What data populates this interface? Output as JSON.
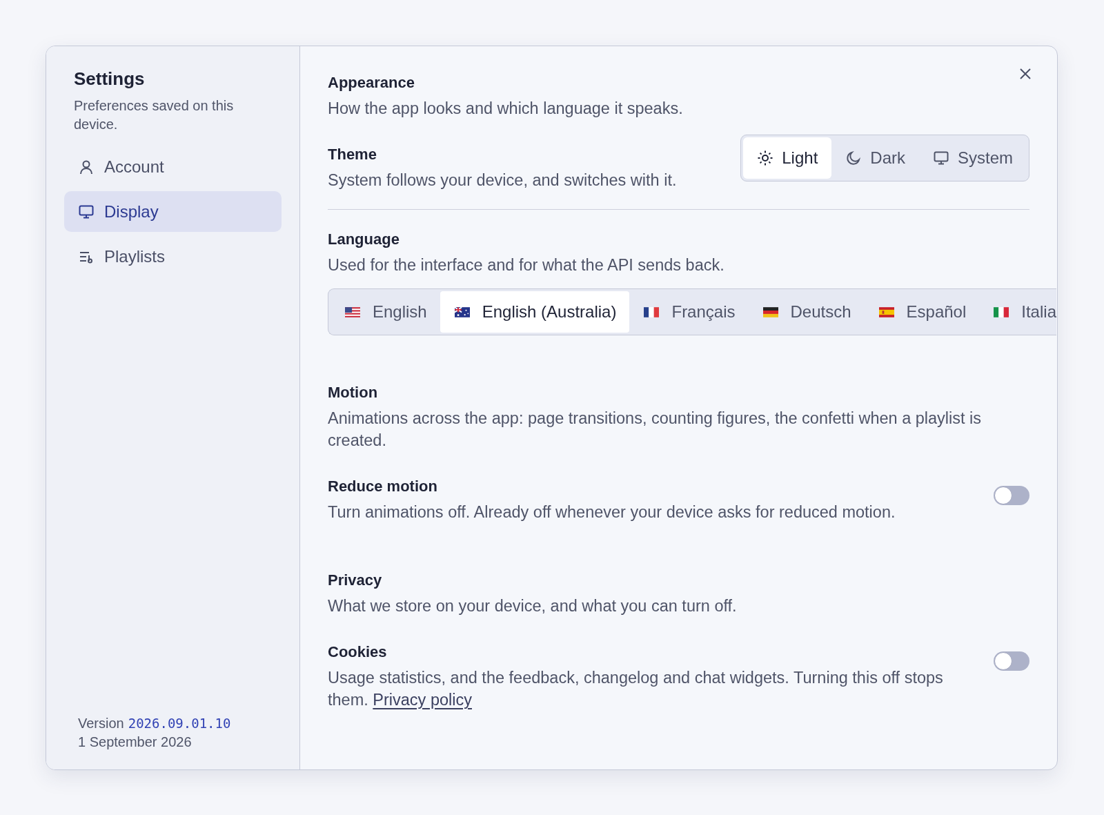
{
  "sidebar": {
    "title": "Settings",
    "subtitle": "Preferences saved on this device.",
    "items": [
      {
        "label": "Account",
        "selected": false
      },
      {
        "label": "Display",
        "selected": true
      },
      {
        "label": "Playlists",
        "selected": false
      }
    ],
    "version_label": "Version",
    "version": "2026.09.01.10",
    "date": "1 September 2026"
  },
  "sections": [
    {
      "title": "Appearance",
      "description": "How the app looks and which language it speaks.",
      "settings": [
        {
          "kind": "segmented",
          "label": "Theme",
          "description": "System follows your device, and switches with it.",
          "options": [
            {
              "label": "Light",
              "selected": true
            },
            {
              "label": "Dark",
              "selected": false
            },
            {
              "label": "System",
              "selected": false
            }
          ]
        },
        {
          "kind": "languages",
          "label": "Language",
          "description": "Used for the interface and for what the API sends back.",
          "options": [
            {
              "label": "English",
              "selected": false
            },
            {
              "label": "English (Australia)",
              "selected": true
            },
            {
              "label": "Français",
              "selected": false
            },
            {
              "label": "Deutsch",
              "selected": false
            },
            {
              "label": "Español",
              "selected": false
            },
            {
              "label": "Italia",
              "selected": false
            }
          ]
        }
      ]
    },
    {
      "title": "Motion",
      "description": "Animations across the app: page transitions, counting figures, the confetti when a playlist is created.",
      "settings": [
        {
          "kind": "toggle",
          "label": "Reduce motion",
          "description": "Turn animations off. Already off whenever your device asks for reduced motion.",
          "on": false
        }
      ]
    },
    {
      "title": "Privacy",
      "description": "What we store on your device, and what you can turn off.",
      "settings": [
        {
          "kind": "toggle",
          "label": "Cookies",
          "description": "Usage statistics, and the feedback, changelog and chat widgets. Turning this off stops them.",
          "link": "Privacy policy",
          "on": false
        }
      ]
    }
  ]
}
